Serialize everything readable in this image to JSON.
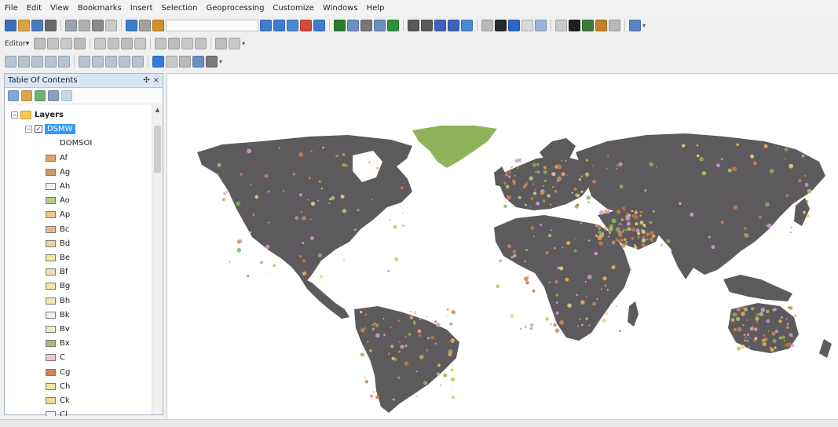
{
  "menu": [
    "File",
    "Edit",
    "View",
    "Bookmarks",
    "Insert",
    "Selection",
    "Geoprocessing",
    "Customize",
    "Windows",
    "Help"
  ],
  "toolbar": {
    "editor_label": "Editor▾",
    "chevron": "▾",
    "standard_colors": [
      "#3b6fb6",
      "#d9a441",
      "#4a7bc0",
      "#6a6a6a",
      "#9aa3ad",
      "#b1b1b1",
      "#8a8a8a",
      "#c9c9c9",
      "#3e7fd0",
      "#a0a0a0",
      "#d0902a"
    ],
    "tools_colors": [
      "#3f7ecf",
      "#3f7ecf",
      "#4a88d4",
      "#d24b3a",
      "#3f7ecf",
      "#2c7a2c",
      "#6b8fc0",
      "#777777",
      "#6b8fc0",
      "#2f8f3f",
      "#5a5a5a",
      "#5a5a5a",
      "#3f63b8",
      "#3f63b8",
      "#4a88d4",
      "#b9b9b9",
      "#2a2a2a",
      "#2a66c8",
      "#d9d9d9",
      "#9ab5d9",
      "#c9c9c9",
      "#1f1f1f",
      "#3c7a3c",
      "#c47d2a",
      "#b9b9b9",
      "#5d82c1"
    ],
    "editor_colors": [
      "#bdbdbd",
      "#c4c4c4",
      "#c9c9c9",
      "#bdbdbd",
      "#c9c9c9",
      "#c4c4c4",
      "#bdbdbd",
      "#c9c9c9",
      "#c4c4c4",
      "#bdbdbd",
      "#c9c9c9",
      "#c4c4c4",
      "#bdbdbd",
      "#c9c9c9"
    ],
    "third_colors": [
      "#b8c3d2",
      "#b8c3d2",
      "#b8c3d2",
      "#b8c3d2",
      "#b8c3d2",
      "#b8c3d2",
      "#b8c3d2",
      "#b8c3d2",
      "#b8c3d2",
      "#b8c3d2",
      "#2f7ed8",
      "#c9c9c9",
      "#b9b9b9",
      "#6a8fc6",
      "#7a7a7a"
    ]
  },
  "toc": {
    "title": "Table Of Contents",
    "pin": "✣",
    "close": "×",
    "root": {
      "expander": "−",
      "label": "Layers"
    },
    "layer": {
      "expander": "−",
      "checked": "✓",
      "label": "DSMW"
    },
    "field": "DOMSOI",
    "legend": [
      {
        "label": "Af",
        "color": "#e4a36b"
      },
      {
        "label": "Ag",
        "color": "#c89a6a"
      },
      {
        "label": "Ah",
        "color": "#f2f2f2"
      },
      {
        "label": "Ao",
        "color": "#b7cf8a"
      },
      {
        "label": "Ap",
        "color": "#f0c58a"
      },
      {
        "label": "Bc",
        "color": "#e7b98a"
      },
      {
        "label": "Bd",
        "color": "#e5d59a"
      },
      {
        "label": "Be",
        "color": "#f3e3a2"
      },
      {
        "label": "Bf",
        "color": "#ece0b8"
      },
      {
        "label": "Bg",
        "color": "#f1e7a9"
      },
      {
        "label": "Bh",
        "color": "#f4e7b0"
      },
      {
        "label": "Bk",
        "color": "#f0f0f0"
      },
      {
        "label": "Bv",
        "color": "#efe9c0"
      },
      {
        "label": "Bx",
        "color": "#a3b97a"
      },
      {
        "label": "C",
        "color": "#f1c6d4"
      },
      {
        "label": "Cg",
        "color": "#c9875d"
      },
      {
        "label": "Ch",
        "color": "#efe6a3"
      },
      {
        "label": "Ck",
        "color": "#eadc90"
      },
      {
        "label": "Cl",
        "color": "#f2f2f2"
      }
    ]
  },
  "map": {
    "land_color": "#5d5a5e",
    "greenland_color": "#8fb35a",
    "class_colors": [
      "#c9875d",
      "#8fb35a",
      "#e6b35a",
      "#d07a3c",
      "#b5c96a",
      "#e9d48a",
      "#d69bd6"
    ]
  }
}
